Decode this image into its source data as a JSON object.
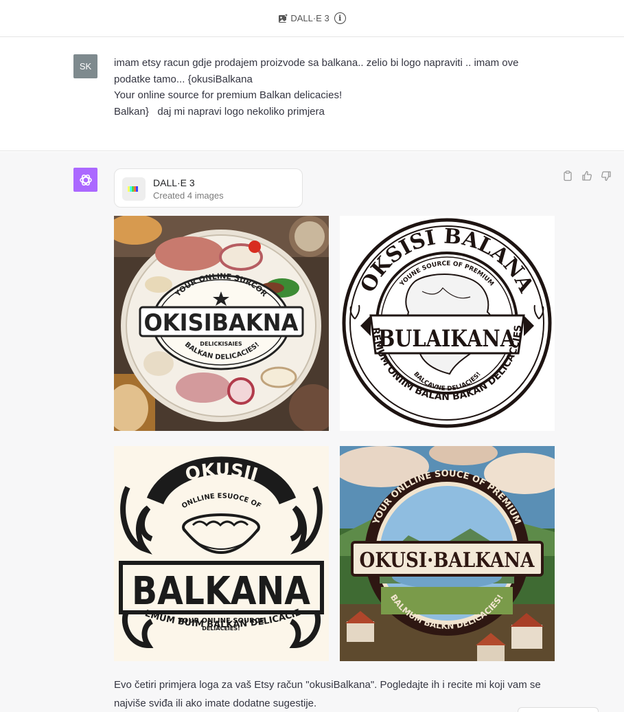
{
  "header": {
    "model_label": "DALL·E 3",
    "info_glyph": "i",
    "icons": [
      "image-plus-icon",
      "info-icon"
    ]
  },
  "user": {
    "initials": "SK",
    "message_lines": [
      "imam etsy racun gdje prodajem proizvode sa balkana.. zelio bi logo napraviti .. imam ove podatke tamo... {okusiBalkana",
      "Your online source for premium Balkan delicacies!",
      "",
      "Balkan}   daj mi napravi logo nekoliko primjera"
    ]
  },
  "assistant": {
    "tool_card": {
      "title": "DALL·E 3",
      "subtitle": "Created 4 images"
    },
    "images": [
      {
        "style": "food-plate",
        "lines": {
          "top": "YOUR ONLINE SURCOR",
          "main": "OKISIBAKNA",
          "sub": "DELICKISAIES",
          "bottom": "BALKAN DELICACIES!"
        }
      },
      {
        "style": "stamp",
        "lines": {
          "top": "OKSISI BALANA",
          "inner": "YOUNE SOURCE OF PREMIUM",
          "main": "BULAIKANA",
          "sub": "BALCAVNE DELIACIES!",
          "bottom": "PREMUM ONIIM BALAN BAKAN DELICACCIES!"
        }
      },
      {
        "style": "bowl-emblem",
        "lines": {
          "top": "OKUSII",
          "inner": "ONLLINE ESUOCE OF",
          "main": "BALKANA",
          "sub1": "YOUR ONLINE SOURCE",
          "sub2": "DELIACEIES!",
          "bottom": "PREMUM BUIM BALKAN DELICACIES!"
        }
      },
      {
        "style": "landscape",
        "lines": {
          "top": "YOUR ONLLINE SOUCE OF PREMIUM",
          "main": "OKUSI·BALKANA",
          "bottom": "BALMUM BALKN DELICACIES!"
        }
      }
    ],
    "reply": "Evo četiri primjera loga za vaš Etsy račun \"okusiBalkana\". Pogledajte ih i recite mi koji vam se najviše sviđa ili ako imate dodatne sugestije.",
    "action_icons": [
      "clipboard-icon",
      "thumbs-up-icon",
      "thumbs-down-icon"
    ]
  },
  "colors": {
    "ai_avatar": "#ab68ff",
    "user_avatar": "#7e8a8e",
    "ai_turn_bg": "#f7f7f8"
  }
}
